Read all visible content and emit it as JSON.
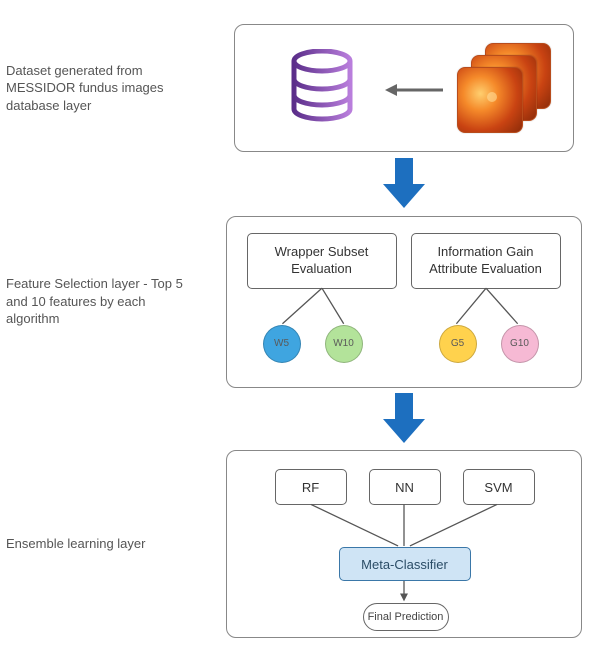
{
  "layers": {
    "data": {
      "label": "Dataset generated from MESSIDOR fundus images database layer",
      "icons": {
        "database": "database-icon",
        "arrow": "arrow-left-icon",
        "images": "fundus-image-stack"
      }
    },
    "feature": {
      "label": "Feature Selection layer - Top 5 and 10 features by each algorithm",
      "methods": {
        "wrapper": "Wrapper Subset Evaluation",
        "infogain": "Information Gain Attribute Evaluation"
      },
      "outputs": {
        "w5": "W5",
        "w10": "W10",
        "g5": "G5",
        "g10": "G10"
      }
    },
    "ensemble": {
      "label": "Ensemble learning layer",
      "classifiers": {
        "rf": "RF",
        "nn": "NN",
        "svm": "SVM"
      },
      "meta": "Meta-Classifier",
      "final": "Final Prediction"
    }
  },
  "colors": {
    "arrow_blue": "#1d6fbf",
    "w5": "#3fa5e0",
    "w10": "#b3e39a",
    "g5": "#ffd24d",
    "g10": "#f6b9d4",
    "meta_bg": "#cfe4f5"
  }
}
